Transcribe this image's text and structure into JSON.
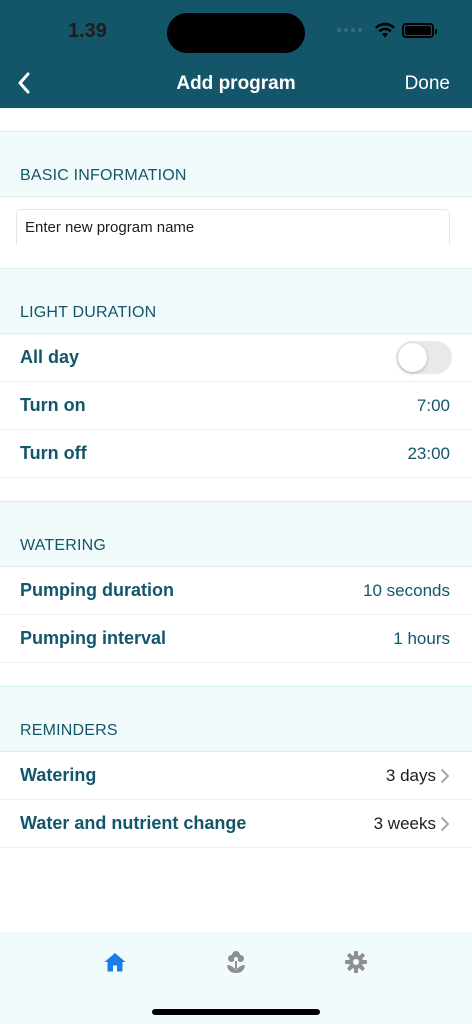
{
  "status": {
    "time": "1.39"
  },
  "nav": {
    "title": "Add program",
    "done_label": "Done"
  },
  "sections": {
    "basic": {
      "header": "BASIC INFORMATION",
      "name_placeholder": "Enter new program name",
      "name_value": ""
    },
    "light": {
      "header": "LIGHT DURATION",
      "all_day_label": "All day",
      "all_day_on": false,
      "turn_on_label": "Turn on",
      "turn_on_value": "7:00",
      "turn_off_label": "Turn off",
      "turn_off_value": "23:00"
    },
    "watering": {
      "header": "WATERING",
      "pump_duration_label": "Pumping duration",
      "pump_duration_value": "10 seconds",
      "pump_interval_label": "Pumping interval",
      "pump_interval_value": "1 hours"
    },
    "reminders": {
      "header": "REMINDERS",
      "watering_label": "Watering",
      "watering_value": "3 days",
      "nutrient_label": "Water and nutrient change",
      "nutrient_value": "3 weeks"
    }
  },
  "tabbar": {
    "tabs": [
      {
        "icon": "home-icon",
        "active": true
      },
      {
        "icon": "plant-icon",
        "active": false
      },
      {
        "icon": "gear-icon",
        "active": false
      }
    ]
  },
  "colors": {
    "header_bg": "#13566a",
    "accent_text": "#13566a",
    "section_bg": "#f1fbfc",
    "tab_active": "#1a7ee6",
    "tab_inactive": "#8e8e93"
  }
}
